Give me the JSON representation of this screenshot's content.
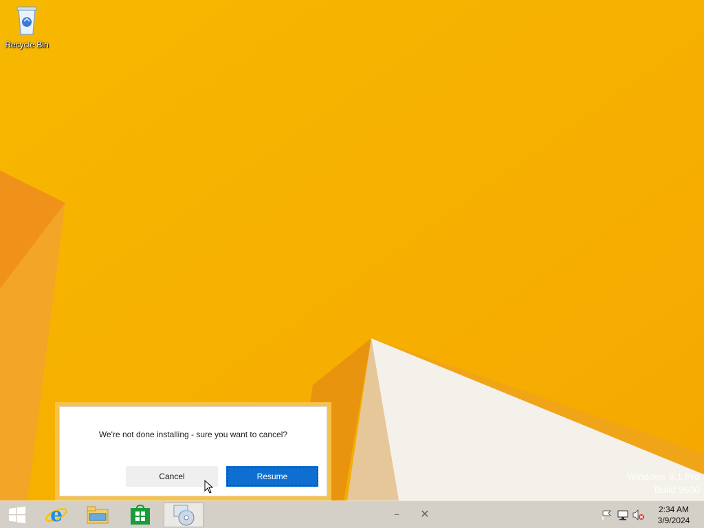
{
  "desktop": {
    "icons": [
      {
        "label": "Recycle Bin",
        "icon": "recycle-bin-icon"
      }
    ],
    "watermark": {
      "line1": "Windows 8.1 Pro",
      "line2": "Build 9600"
    }
  },
  "dialog": {
    "message": "We're not done installing - sure you want to cancel?",
    "cancel_label": "Cancel",
    "resume_label": "Resume",
    "accent_color": "#0f6fd0"
  },
  "taskbar": {
    "pinned": [
      "windows-start-icon",
      "internet-explorer-icon",
      "file-explorer-icon",
      "store-icon",
      "setup-disc-icon"
    ],
    "window_controls": {
      "minimize": "–",
      "close": "✕"
    },
    "tray": [
      "action-center-flag-icon",
      "network-icon",
      "volume-muted-icon"
    ],
    "clock": {
      "time": "2:34 AM",
      "date": "3/9/2024"
    }
  },
  "colors": {
    "wallpaper": "#f5b400",
    "taskbar": "#d4d0c8",
    "dialog_border": "#f7c24a"
  }
}
